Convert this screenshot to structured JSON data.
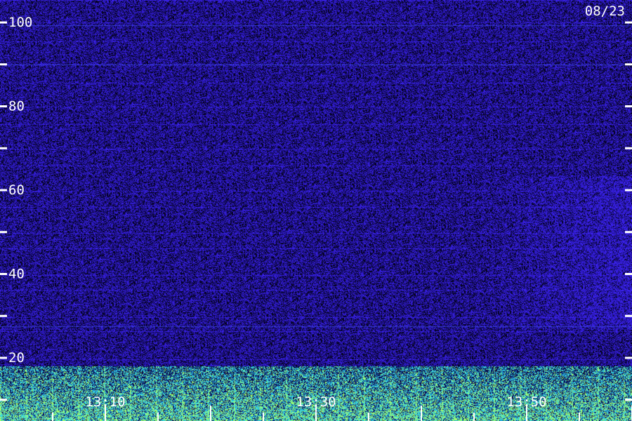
{
  "chart_data": {
    "type": "heatmap",
    "title": "",
    "xlabel": "",
    "ylabel": "",
    "date_label": "08/23",
    "x_axis": {
      "labeled_ticks": [
        "13:10",
        "13:30",
        "13:50"
      ],
      "range_minutes": [
        "13:05",
        "14:05"
      ],
      "major_tick_every_min": 10,
      "minor_tick_every_min": 5
    },
    "y_axis": {
      "labeled_ticks": [
        20,
        40,
        60,
        80,
        100
      ],
      "all_ticks": [
        10,
        20,
        30,
        40,
        50,
        60,
        70,
        80,
        90,
        100
      ],
      "range": [
        0,
        105
      ]
    },
    "intensity_description": "noise floor dark blue/purple; strong signal (cyan/green) concentrated below ~18 on the y axis across the full time range; slightly brighter blue region at high y on the right side (after ~13:55) between ~25 and ~60",
    "colors": {
      "background": "#000000",
      "noise_low": "#120a4a",
      "noise_high": "#3a2ad8",
      "signal": "#3ff0e0",
      "signal_hot": "#a0ff60",
      "text": "#ffffff"
    }
  }
}
